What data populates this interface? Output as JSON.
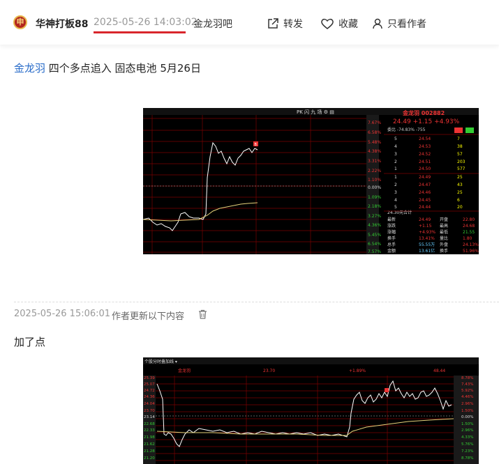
{
  "header": {
    "avatar_text": "申",
    "author": "华神打板88",
    "post_time": "2025-05-26 14:03:02",
    "forum": "金龙羽吧",
    "actions": {
      "share": "转发",
      "favorite": "收藏",
      "author_only": "只看作者"
    }
  },
  "post": {
    "stock_link": "金龙羽",
    "title_rest": " 四个多点追入  固态电池  5月26日"
  },
  "chart1": {
    "stock_name": "金龙羽",
    "stock_code": "002882",
    "price": "24.49",
    "change": "+1.15",
    "change_pct": "+4.93%",
    "weibi_label": "委比",
    "weibi": "-74.83%",
    "weicha": "-755",
    "buy_btn": "买",
    "sell_btn": "卖",
    "pct_ticks": [
      "7.67%",
      "6.58%",
      "5.48%",
      "4.38%",
      "3.31%",
      "2.22%",
      "1.10%",
      "0.00%",
      "1.09%",
      "2.18%",
      "3.27%",
      "4.36%",
      "5.45%",
      "6.54%",
      "7.57%"
    ],
    "sell_rows": [
      {
        "lvl": "5",
        "price": "24.54",
        "vol": "7"
      },
      {
        "lvl": "4",
        "price": "24.53",
        "vol": "38"
      },
      {
        "lvl": "3",
        "price": "24.52",
        "vol": "57"
      },
      {
        "lvl": "2",
        "price": "24.51",
        "vol": "203"
      },
      {
        "lvl": "1",
        "price": "24.50",
        "vol": "577"
      }
    ],
    "buy_rows": [
      {
        "lvl": "1",
        "price": "24.49",
        "vol": "25"
      },
      {
        "lvl": "2",
        "price": "24.47",
        "vol": "43"
      },
      {
        "lvl": "3",
        "price": "24.46",
        "vol": "25"
      },
      {
        "lvl": "4",
        "price": "24.45",
        "vol": "6"
      },
      {
        "lvl": "5",
        "price": "24.44",
        "vol": "20"
      }
    ],
    "stats": [
      {
        "k": "最新",
        "v": "24.49",
        "k2": "开盘",
        "v2": "22.80"
      },
      {
        "k": "涨跌",
        "v": "+1.15",
        "k2": "最高",
        "v2": "24.68"
      },
      {
        "k": "涨幅",
        "v": "+4.93%",
        "k2": "最低",
        "v2": "21.55"
      },
      {
        "k": "换手",
        "v": "13.41%",
        "k2": "量比",
        "v2": "1.80"
      },
      {
        "k": "总手",
        "v": "55.55万",
        "k2": "外盘",
        "v2": "24.13%"
      },
      {
        "k": "金额",
        "v": "13.61亿",
        "k2": "换手(实)",
        "v2": "51.96%"
      }
    ],
    "mid_label": "24.30元合计"
  },
  "update": {
    "time": "2025-05-26 15:06:01",
    "text": "作者更新以下内容"
  },
  "body_text": "加了点",
  "chart2": {
    "tab_label": "个股分时叠加线",
    "stock_name": "金龙羽",
    "price_ticks": [
      "25.39",
      "25.07",
      "24.72",
      "24.36",
      "24.04",
      "23.70",
      "23.14",
      "22.68",
      "22.33",
      "21.98",
      "21.62",
      "21.28",
      "21.20"
    ],
    "pct_ticks": [
      "8.78%",
      "7.43%",
      "5.92%",
      "4.46%",
      "2.96%",
      "1.50%",
      "0.00%",
      "1.50%",
      "2.96%",
      "4.33%",
      "5.76%",
      "7.23%",
      "8.78%"
    ]
  },
  "colors": {
    "accent": "#d9262c",
    "link": "#2b6dc9",
    "up": "#ff3333",
    "down": "#33cc33"
  }
}
